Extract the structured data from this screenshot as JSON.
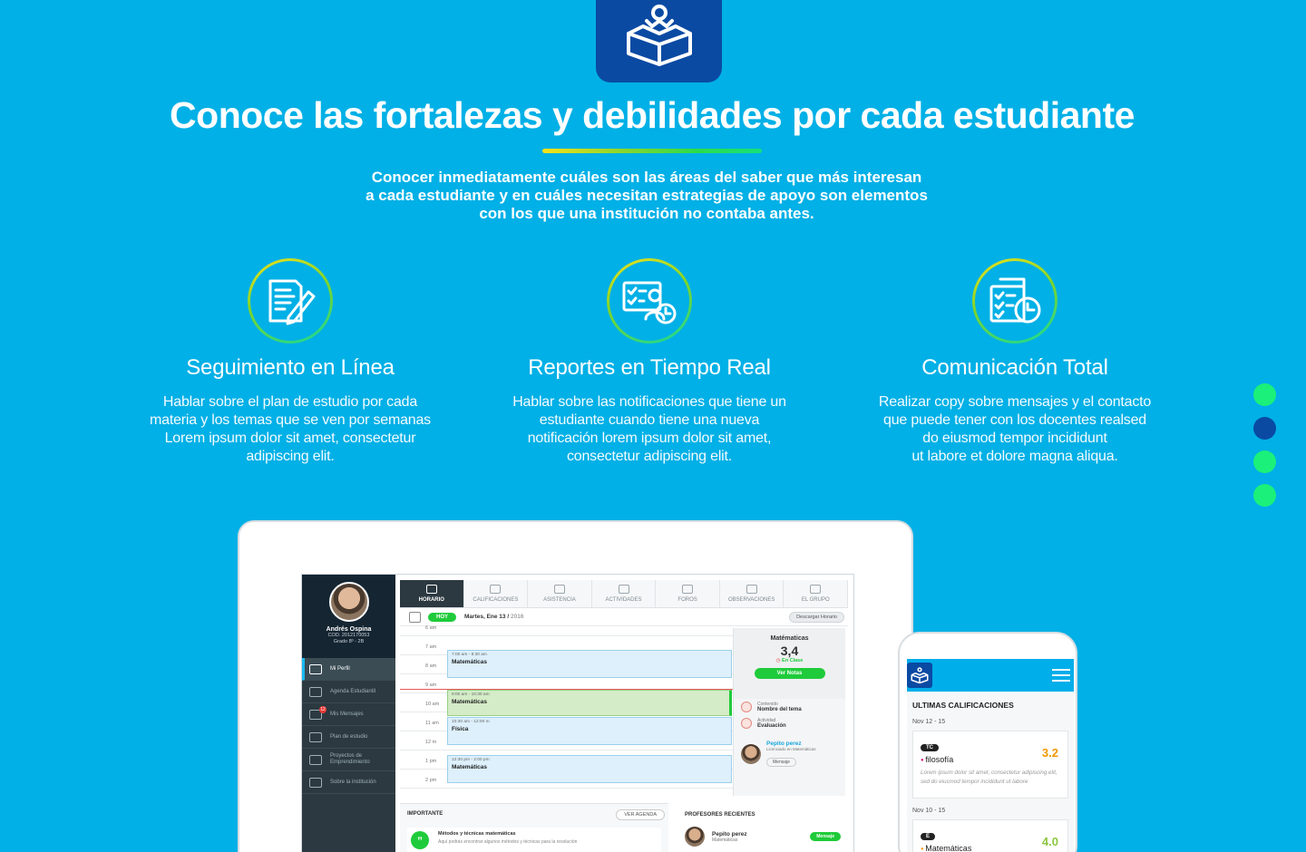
{
  "hero": {
    "title": "Conoce las fortalezas y debilidades por cada estudiante",
    "intro_lines": [
      "Conocer inmediatamente cuáles son las áreas del saber que más interesan",
      "a cada estudiante y en cuáles necesitan estrategias de apoyo son elementos",
      "con los que una institución no contaba antes."
    ]
  },
  "features": [
    {
      "title": "Seguimiento en Línea",
      "icon": "document-pencil-icon",
      "lines": [
        "Hablar sobre el plan de estudio por cada",
        "materia y los temas que se ven por semanas",
        "Lorem ipsum dolor sit amet, consectetur",
        "adipiscing elit."
      ]
    },
    {
      "title": "Reportes en Tiempo Real",
      "icon": "checklist-user-clock-icon",
      "lines": [
        "Hablar sobre las notificaciones que tiene un",
        "estudiante cuando tiene una nueva",
        "notificación lorem ipsum dolor sit amet,",
        "consectetur adipiscing elit."
      ]
    },
    {
      "title": "Comunicación Total",
      "icon": "checklist-clock-icon",
      "lines": [
        "Realizar copy sobre mensajes y el contacto",
        "que puede tener con los docentes realsed",
        "do eiusmod tempor incididunt",
        "ut labore et dolore magna aliqua."
      ]
    }
  ],
  "pager": {
    "count": 4,
    "active_index": 1
  },
  "colors": {
    "background": "#00b0e6",
    "brand_dark": "#0a4aa3",
    "accent_green": "#1fcb3a"
  },
  "app": {
    "student": {
      "name": "Andrés Ospina",
      "code": "COD. 2012170053",
      "grade": "Grado 8º - 2B"
    },
    "sidebar": [
      {
        "label": "Mi Perfil",
        "active": true
      },
      {
        "label": "Agenda Estudiantil"
      },
      {
        "label": "Mis Mensajes",
        "badge": "12"
      },
      {
        "label": "Plan de estudio"
      },
      {
        "label": "Proyectos de Emprendimiento"
      },
      {
        "label": "Sobre la institución"
      }
    ],
    "tabs": [
      "HORARIO",
      "CALIFICACIONES",
      "ASISTENCIA",
      "ACTIVIDADES",
      "FOROS",
      "OBSERVACIONES",
      "EL GRUPO"
    ],
    "today_label": "HOY",
    "date": "Martes, Ene 13 /",
    "year": "2016",
    "download": "Descargar Horario",
    "hours": [
      "6 am",
      "7 am",
      "8 am",
      "9 am",
      "10 am",
      "11 am",
      "12 m",
      "1 pm",
      "2 pm"
    ],
    "events": [
      {
        "time": "7:00 am - 8:30 am",
        "subject": "Matemáticas"
      },
      {
        "time": "9:00 am - 10:30 am",
        "subject": "Matemáticas"
      },
      {
        "time": "10:30 am - 12:00 m",
        "subject": "Física"
      },
      {
        "time": "12:30 pm - 2:00 pm",
        "subject": "Matemáticas"
      }
    ],
    "detail": {
      "subject": "Matématicas",
      "grade": "3,4",
      "status": "En Clase",
      "button": "Ver Notas",
      "content_label": "Contenido",
      "content_value": "Nombre del tema",
      "activity_label": "Actividad",
      "activity_value": "Evaluación",
      "teacher_name": "Pepito perez",
      "teacher_role": "Licenciado en Matemáticas",
      "message_button": "Mensaje"
    },
    "important": {
      "title": "IMPORTANTE",
      "button": "VER AGENDA",
      "item_title": "Métodos y técnicas matemáticas",
      "item_desc": "Aquí podrás encontrar algunos métodos y técnicas para la resolución"
    },
    "recent_teachers": {
      "title": "PROFESORES RECIENTES",
      "name": "Pepito perez",
      "subject": "Matemáticas",
      "button": "Mensaje"
    }
  },
  "phone": {
    "title": "ULTIMAS CALIFICACIONES",
    "groups": [
      {
        "range": "Nov 12 - 15",
        "tag": "TC",
        "subject": "filosofía",
        "score": "3.2",
        "desc": "Lorem ipsum dolor sit amet, consectetur adipiscing elit, sed do eiusmod tempor incididunt ut labore"
      },
      {
        "range": "Nov 10 - 15",
        "tag": "E",
        "subject": "Matemáticas",
        "score": "4.0",
        "desc": ""
      }
    ]
  }
}
